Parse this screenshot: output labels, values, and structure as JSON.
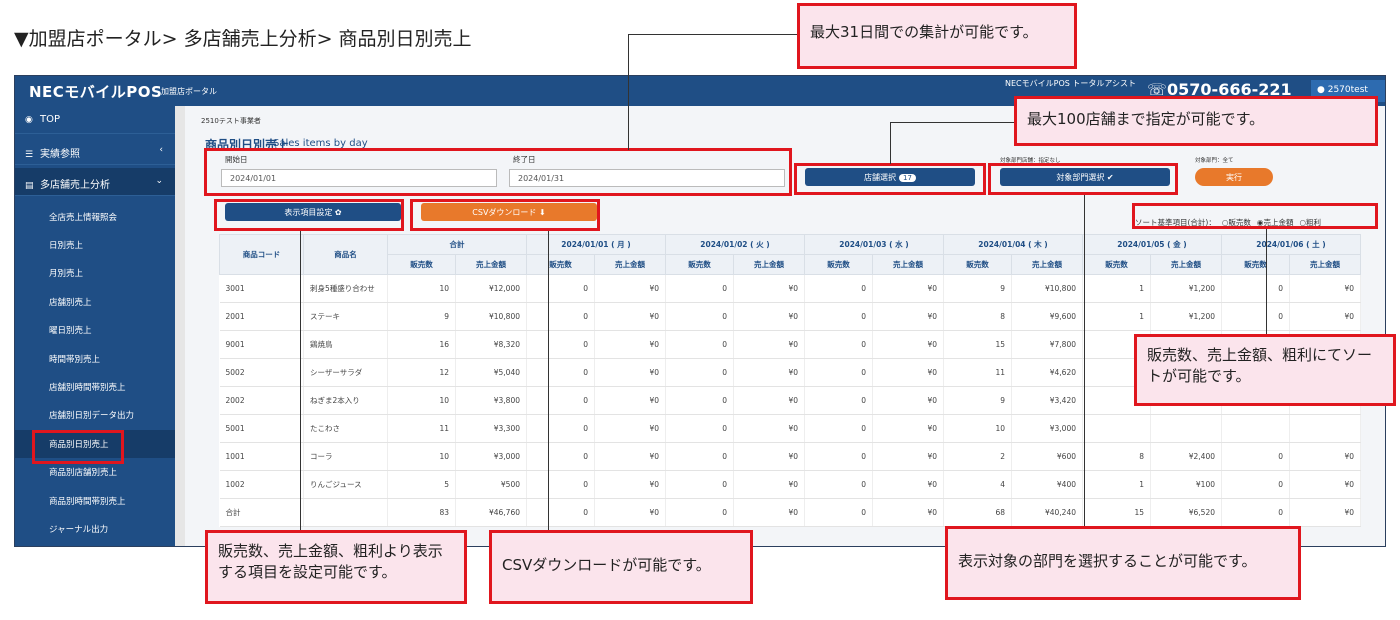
{
  "page_heading": "▼加盟店ポータル> 多店舗売上分析> 商品別日別売上",
  "topbar": {
    "brand": "NECモバイルPOS",
    "brand_sub": "加盟店ポータル",
    "support_line1": "NECモバイルPOS トータルアシスト",
    "support_line2": "",
    "phone": "0570-666-221",
    "user": "2570test"
  },
  "sidebar": {
    "items": [
      {
        "label": "TOP",
        "icon": "dashboard-icon"
      },
      {
        "label": "実績参照",
        "icon": "list-icon"
      },
      {
        "label": "多店舗売上分析",
        "icon": "database-icon"
      }
    ],
    "sub_items": [
      {
        "label": "全店売上情報照会"
      },
      {
        "label": "日別売上"
      },
      {
        "label": "月別売上"
      },
      {
        "label": "店舗別売上"
      },
      {
        "label": "曜日別売上"
      },
      {
        "label": "時間帯別売上"
      },
      {
        "label": "店舗別時間帯別売上"
      },
      {
        "label": "店舗別日別データ出力"
      },
      {
        "label": "商品別日別売上"
      },
      {
        "label": "商品別店舗別売上"
      },
      {
        "label": "商品別時間帯別売上"
      },
      {
        "label": "ジャーナル出力"
      }
    ]
  },
  "content": {
    "business_name": "2510テスト事業者",
    "title": "商品別日別売上",
    "title_en": "Sales items by day",
    "start_label": "開始日",
    "start_value": "2024/01/01",
    "end_label": "終了日",
    "end_value": "2024/01/31",
    "store_select_label": "店舗選択",
    "store_count": "17",
    "dept_store_note": "対象部門店舗：指定なし",
    "dept_note": "対象部門：全て",
    "dept_select_label": "対象部門選択 ✔",
    "exec_label": "実行",
    "display_settings_label": "表示項目設定 ✿",
    "csv_label": "CSVダウンロード ⬇",
    "sort_label": "ソート基準項目(合計)：",
    "sort_options": [
      "○販売数",
      "◉売上金額",
      "○粗利"
    ]
  },
  "table": {
    "col_code": "商品コード",
    "col_name": "商品名",
    "groups": [
      "合計",
      "2024/01/01 ( 月 )",
      "2024/01/02 ( 火 )",
      "2024/01/03 ( 水 )",
      "2024/01/04 ( 木 )",
      "2024/01/05 ( 金 )",
      "2024/01/06 ( 土 )"
    ],
    "sub_qty": "販売数",
    "sub_amount": "売上金額",
    "rows": [
      {
        "code": "3001",
        "name": "刺身5種盛り合わせ",
        "cells": [
          "10",
          "¥12,000",
          "0",
          "¥0",
          "0",
          "¥0",
          "0",
          "¥0",
          "9",
          "¥10,800",
          "1",
          "¥1,200",
          "0",
          "¥0"
        ]
      },
      {
        "code": "2001",
        "name": "ステーキ",
        "cells": [
          "9",
          "¥10,800",
          "0",
          "¥0",
          "0",
          "¥0",
          "0",
          "¥0",
          "8",
          "¥9,600",
          "1",
          "¥1,200",
          "0",
          "¥0"
        ]
      },
      {
        "code": "9001",
        "name": "鶏焼鳥",
        "cells": [
          "16",
          "¥8,320",
          "0",
          "¥0",
          "0",
          "¥0",
          "0",
          "¥0",
          "15",
          "¥7,800",
          "",
          "",
          "",
          ""
        ]
      },
      {
        "code": "5002",
        "name": "シーザーサラダ",
        "cells": [
          "12",
          "¥5,040",
          "0",
          "¥0",
          "0",
          "¥0",
          "0",
          "¥0",
          "11",
          "¥4,620",
          "",
          "",
          "",
          ""
        ]
      },
      {
        "code": "2002",
        "name": "ねぎま2本入り",
        "cells": [
          "10",
          "¥3,800",
          "0",
          "¥0",
          "0",
          "¥0",
          "0",
          "¥0",
          "9",
          "¥3,420",
          "",
          "",
          "",
          ""
        ]
      },
      {
        "code": "5001",
        "name": "たこわさ",
        "cells": [
          "11",
          "¥3,300",
          "0",
          "¥0",
          "0",
          "¥0",
          "0",
          "¥0",
          "10",
          "¥3,000",
          "",
          "",
          "",
          ""
        ]
      },
      {
        "code": "1001",
        "name": "コーラ",
        "cells": [
          "10",
          "¥3,000",
          "0",
          "¥0",
          "0",
          "¥0",
          "0",
          "¥0",
          "2",
          "¥600",
          "8",
          "¥2,400",
          "0",
          "¥0"
        ]
      },
      {
        "code": "1002",
        "name": "りんごジュース",
        "cells": [
          "5",
          "¥500",
          "0",
          "¥0",
          "0",
          "¥0",
          "0",
          "¥0",
          "4",
          "¥400",
          "1",
          "¥100",
          "0",
          "¥0"
        ]
      }
    ],
    "total_label": "合計",
    "total_cells": [
      "83",
      "¥46,760",
      "0",
      "¥0",
      "0",
      "¥0",
      "0",
      "¥0",
      "68",
      "¥40,240",
      "15",
      "¥6,520",
      "0",
      "¥0"
    ]
  },
  "callouts": {
    "days": "最大31日間での集計が可能です。",
    "stores": "最大100店舗まで指定が可能です。",
    "sort": "販売数、売上金額、粗利にてソートが可能です。",
    "display": "販売数、売上金額、粗利より表示する項目を設定可能です。",
    "csv": "CSVダウンロードが可能です。",
    "dept": "表示対象の部門を選択することが可能です。"
  }
}
